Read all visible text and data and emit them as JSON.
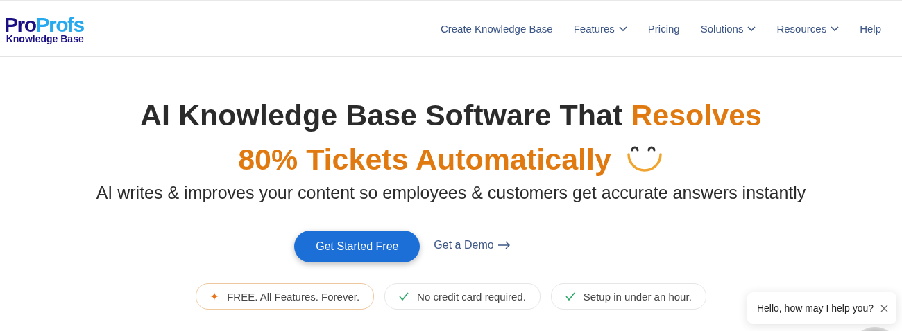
{
  "logo": {
    "parts": [
      "Pro",
      "Profs"
    ],
    "subtitle": "Knowledge Base"
  },
  "nav": [
    {
      "label": "Create Knowledge Base",
      "dropdown": false
    },
    {
      "label": "Features",
      "dropdown": true
    },
    {
      "label": "Pricing",
      "dropdown": false
    },
    {
      "label": "Solutions",
      "dropdown": true
    },
    {
      "label": "Resources",
      "dropdown": true
    },
    {
      "label": "Help",
      "dropdown": false
    }
  ],
  "hero": {
    "headline": [
      [
        {
          "text": "AI Knowledge Base Software That ",
          "highlight": false
        },
        {
          "text": "Resolves",
          "highlight": true
        }
      ],
      [
        {
          "text": "80% Tickets Automatically",
          "highlight": true
        }
      ]
    ],
    "subtitle": "AI writes & improves your content so employees & customers get accurate answers instantly",
    "primary_button": "Get Started Free",
    "secondary_link": "Get a Demo"
  },
  "badges": [
    {
      "kind": "sparkle",
      "text": "FREE. All Features. Forever."
    },
    {
      "kind": "check",
      "text": "No credit card required."
    },
    {
      "kind": "check",
      "text": "Setup in under an hour."
    }
  ],
  "chat": {
    "message": "Hello, how may I help you?"
  }
}
